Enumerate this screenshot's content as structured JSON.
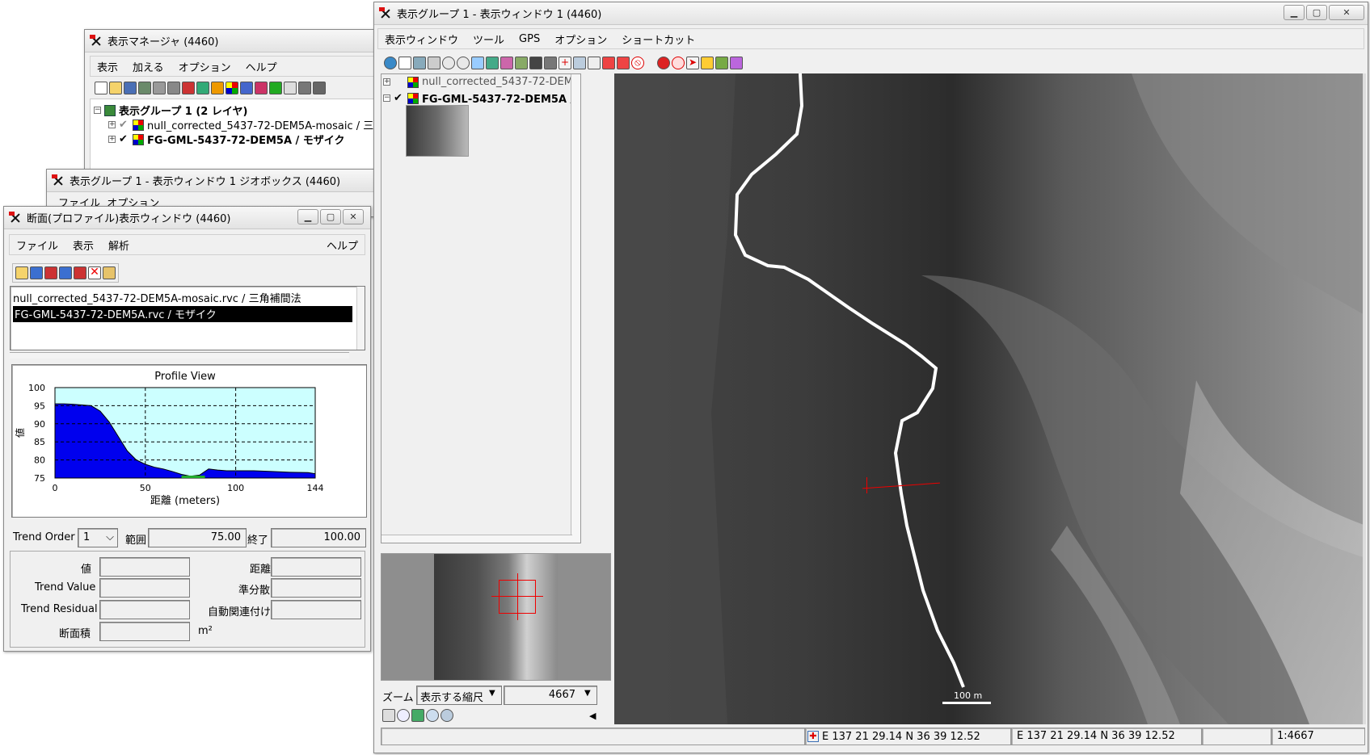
{
  "display_manager": {
    "title": "表示マネージャ (4460)",
    "menu": [
      "表示",
      "加える",
      "オプション",
      "ヘルプ"
    ],
    "group_label": "表示グループ 1  (2 レイヤ)",
    "layers": [
      "null_corrected_5437-72-DEM5A-mosaic / 三",
      "FG-GML-5437-72-DEM5A / モザイク"
    ]
  },
  "geobox_window": {
    "title": "表示グループ 1  - 表示ウィンドウ 1 ジオボックス (4460)",
    "menu_partial": "ファイル  オプション"
  },
  "profile_window": {
    "title": "断面(プロファイル)表示ウィンドウ (4460)",
    "menu_left": [
      "ファイル",
      "表示",
      "解析"
    ],
    "menu_help": "ヘルプ",
    "layers": [
      "null_corrected_5437-72-DEM5A-mosaic.rvc / 三角補間法",
      "FG-GML-5437-72-DEM5A.rvc / モザイク"
    ],
    "trend_order_label": "Trend Order",
    "trend_order_value": "1",
    "range_label": "範囲",
    "range_value": "75.00",
    "end_label": "終了",
    "end_value": "100.00",
    "stats": {
      "value_label": "値",
      "distance_label": "距離",
      "trend_value_label": "Trend Value",
      "variance_label": "準分散",
      "trend_residual_label": "Trend Residual",
      "autocorr_label": "自動関連付け",
      "area_label": "断面積",
      "area_unit": "m²"
    }
  },
  "chart_data": {
    "type": "area",
    "title": "Profile View",
    "xlabel": "距離 (meters)",
    "ylabel": "値",
    "xlim": [
      0,
      144
    ],
    "ylim": [
      75,
      100
    ],
    "xticks": [
      0,
      50,
      100,
      144
    ],
    "yticks": [
      75,
      80,
      85,
      90,
      95,
      100
    ],
    "grid": true,
    "series": [
      {
        "fill_color": "#0000ee",
        "x": [
          0,
          5,
          10,
          15,
          20,
          25,
          30,
          35,
          40,
          45,
          50,
          55,
          60,
          65,
          70,
          75,
          80,
          85,
          90,
          95,
          100,
          110,
          120,
          130,
          140,
          144
        ],
        "y": [
          95.5,
          95.5,
          95.4,
          95.2,
          95.0,
          93.5,
          90.5,
          86.5,
          82.5,
          80.0,
          78.8,
          78.0,
          77.5,
          76.8,
          76.0,
          75.5,
          75.8,
          77.5,
          77.2,
          77.0,
          77.0,
          77.0,
          76.8,
          76.6,
          76.5,
          76.2
        ]
      }
    ],
    "no_data_segment": {
      "x": [
        70,
        83
      ],
      "color": "#1faa2a"
    }
  },
  "main_view": {
    "title": "表示グループ 1  - 表示ウィンドウ 1 (4460)",
    "menu": [
      "表示ウィンドウ",
      "ツール",
      "GPS",
      "オプション",
      "ショートカット"
    ],
    "layers": [
      "null_corrected_5437-72-DEM5A-m",
      "FG-GML-5437-72-DEM5A / モザ"
    ],
    "zoom_label": "ズーム",
    "zoom_mode": "表示する縮尺",
    "zoom_value": "4667",
    "scale_bar_label": "100 m",
    "status": {
      "coord1": "E 137 21 29.14  N 36 39 12.52",
      "coord2": "E 137 21 29.14  N 36 39 12.52",
      "scale": "1:4667"
    }
  },
  "colors": {
    "chart_bg": "#ccffff",
    "profile_fill": "#0000ee",
    "selection_bg": "#000000",
    "cross_marker": "#dd0000"
  }
}
